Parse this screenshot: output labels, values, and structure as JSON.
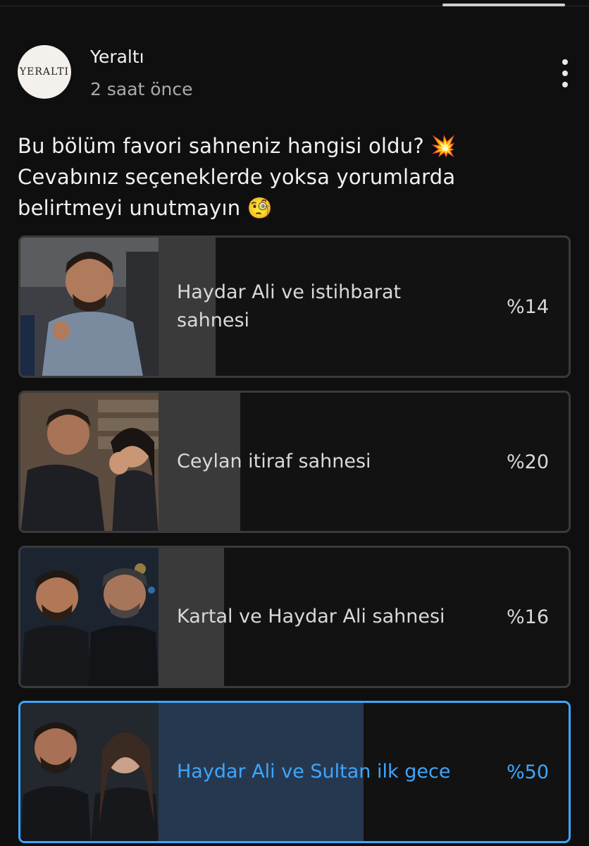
{
  "channel": {
    "avatar_text": "YERALTI",
    "name": "Yeraltı",
    "time": "2 saat önce"
  },
  "post": {
    "lines": [
      "Bu bölüm favori sahneniz hangisi oldu? 💥",
      "Cevabınız seçeneklerde yoksa yorumlarda",
      "belirtmeyi unutmayın 🧐"
    ]
  },
  "poll": {
    "options": [
      {
        "label": "Haydar Ali ve istihbarat sahnesi",
        "percent_text": "%14",
        "percent": 14,
        "selected": false
      },
      {
        "label": "Ceylan itiraf sahnesi",
        "percent_text": "%20",
        "percent": 20,
        "selected": false
      },
      {
        "label": "Kartal ve Haydar Ali sahnesi",
        "percent_text": "%16",
        "percent": 16,
        "selected": false
      },
      {
        "label": "Haydar Ali ve Sultan ilk gece",
        "percent_text": "%50",
        "percent": 50,
        "selected": true
      }
    ]
  },
  "colors": {
    "accent": "#3ea6ff",
    "background": "#0f0f0f",
    "bar": "#3a3a3a"
  }
}
